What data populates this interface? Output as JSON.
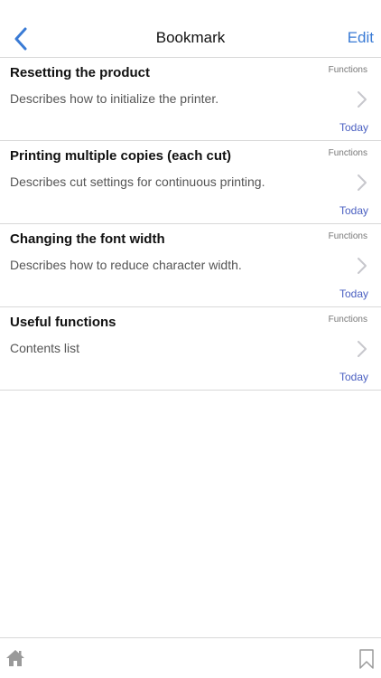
{
  "header": {
    "title": "Bookmark",
    "edit_label": "Edit",
    "back_icon": "chevron-left-icon"
  },
  "bookmarks": [
    {
      "title": "Resetting the product",
      "category": "Functions",
      "description": "Describes how to initialize the printer.",
      "date": "Today"
    },
    {
      "title": "Printing multiple copies (each cut)",
      "category": "Functions",
      "description": "Describes cut settings for continuous printing.",
      "date": "Today"
    },
    {
      "title": "Changing the font width",
      "category": "Functions",
      "description": "Describes how to reduce character width.",
      "date": "Today"
    },
    {
      "title": "Useful functions",
      "category": "Functions",
      "description": "Contents list",
      "date": "Today"
    }
  ],
  "toolbar": {
    "home_icon": "home-icon",
    "bookmark_icon": "bookmark-icon"
  },
  "colors": {
    "accent": "#3a7bd5",
    "date": "#4a5fc1",
    "divider": "#d8d8d8",
    "icon_gray": "#9a9a9a"
  }
}
